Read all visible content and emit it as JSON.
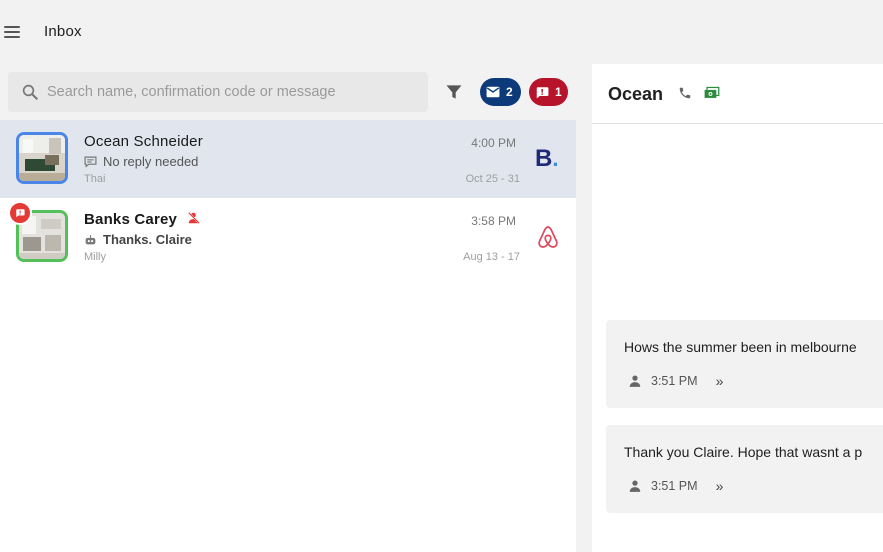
{
  "header": {
    "title": "Inbox"
  },
  "search": {
    "placeholder": "Search name, confirmation code or message"
  },
  "filters": {
    "mail_count": "2",
    "alert_count": "1"
  },
  "conversations": [
    {
      "name": "Ocean Schneider",
      "status": "No reply needed",
      "listing": "Thai",
      "time": "4:00 PM",
      "dates": "Oct 25 - 31",
      "channel": "booking"
    },
    {
      "name": "Banks Carey",
      "status": "Thanks. Claire",
      "listing": "Milly",
      "time": "3:58 PM",
      "dates": "Aug 13 - 17",
      "channel": "airbnb"
    }
  ],
  "chat": {
    "title": "Ocean",
    "messages": [
      {
        "text": "Hows the summer been in melbourne",
        "time": "3:51 PM"
      },
      {
        "text": "Thank you Claire. Hope that wasnt a p",
        "time": "3:51 PM"
      }
    ]
  },
  "colors": {
    "accent_blue": "#0d3b7a",
    "alert_red": "#b7142b",
    "booking_navy": "#1e2a78",
    "airbnb_red": "#e0485a"
  }
}
